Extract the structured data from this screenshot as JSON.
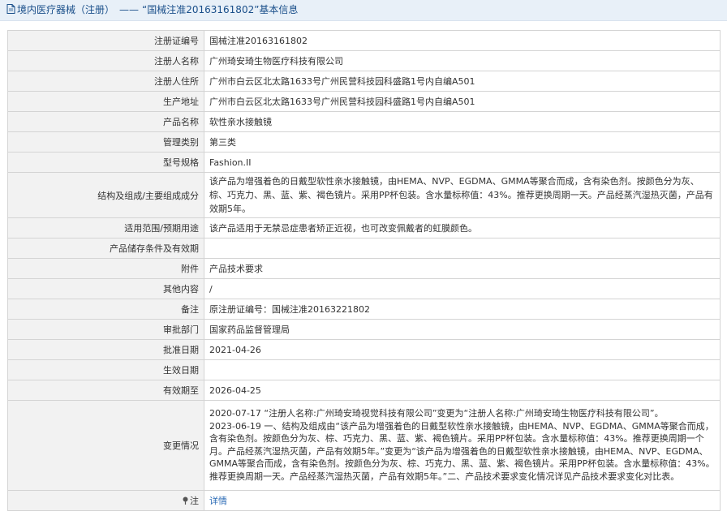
{
  "header": {
    "category": "境内医疗器械（注册）",
    "separator": "——",
    "title": "“国械注准20163161802”基本信息"
  },
  "rows": [
    {
      "label": "注册证编号",
      "value": "国械注准20163161802"
    },
    {
      "label": "注册人名称",
      "value": "广州琦安琦生物医疗科技有限公司"
    },
    {
      "label": "注册人住所",
      "value": "广州市白云区北太路1633号广州民营科技园科盛路1号内自编A501"
    },
    {
      "label": "生产地址",
      "value": "广州市白云区北太路1633号广州民营科技园科盛路1号内自编A501"
    },
    {
      "label": "产品名称",
      "value": "软性亲水接触镜"
    },
    {
      "label": "管理类别",
      "value": "第三类"
    },
    {
      "label": "型号规格",
      "value": "Fashion.II"
    },
    {
      "label": "结构及组成/主要组成成分",
      "value": "该产品为增强着色的日戴型软性亲水接触镜，由HEMA、NVP、EGDMA、GMMA等聚合而成，含有染色剂。按颜色分为灰、棕、巧克力、黑、蓝、紫、褐色镜片。采用PP杯包装。含水量标称值：43%。推荐更换周期一天。产品经蒸汽湿热灭菌，产品有效期5年。"
    },
    {
      "label": "适用范围/预期用途",
      "value": "该产品适用于无禁忌症患者矫正近视，也可改变佩戴者的虹膜颜色。"
    },
    {
      "label": "产品储存条件及有效期",
      "value": ""
    },
    {
      "label": "附件",
      "value": "产品技术要求"
    },
    {
      "label": "其他内容",
      "value": "/"
    },
    {
      "label": "备注",
      "value": "原注册证编号：国械注准20163221802"
    },
    {
      "label": "审批部门",
      "value": "国家药品监督管理局"
    },
    {
      "label": "批准日期",
      "value": "2021-04-26"
    },
    {
      "label": "生效日期",
      "value": ""
    },
    {
      "label": "有效期至",
      "value": "2026-04-25"
    },
    {
      "label": "变更情况",
      "value": "2020-07-17 “注册人名称:广州琦安琦视觉科技有限公司”变更为“注册人名称:广州琦安琦生物医疗科技有限公司”。\n2023-06-19 一、结构及组成由“该产品为增强着色的日戴型软性亲水接触镜，由HEMA、NVP、EGDMA、GMMA等聚合而成，含有染色剂。按颜色分为灰、棕、巧克力、黑、蓝、紫、褐色镜片。采用PP杯包装。含水量标称值：43%。推荐更换周期一个月。产品经蒸汽湿热灭菌，产品有效期5年。”变更为“该产品为增强着色的日戴型软性亲水接触镜，由HEMA、NVP、EGDMA、GMMA等聚合而成，含有染色剂。按颜色分为灰、棕、巧克力、黑、蓝、紫、褐色镜片。采用PP杯包装。含水量标称值：43%。推荐更换周期一天。产品经蒸汽湿热灭菌，产品有效期5年。”二、产品技术要求变化情况详见产品技术要求变化对比表。"
    }
  ],
  "note": {
    "label": "注",
    "link": "详情"
  }
}
